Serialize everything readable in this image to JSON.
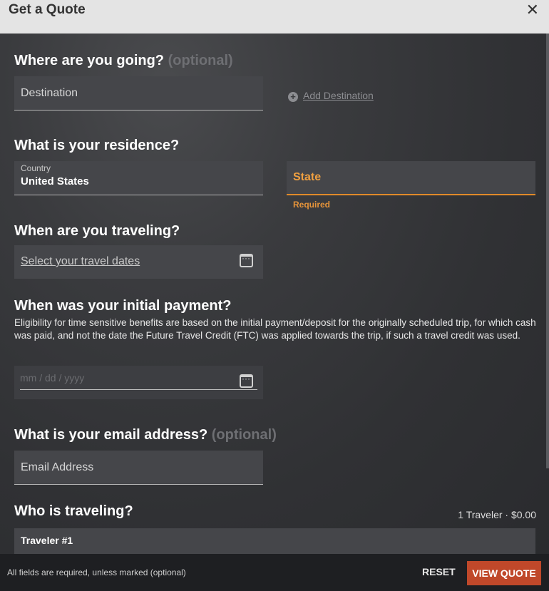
{
  "dialog": {
    "title": "Get a Quote",
    "close_icon": "close-icon",
    "close_glyph": "✕"
  },
  "destination": {
    "heading": "Where are you going?",
    "optional": "(optional)",
    "placeholder": "Destination",
    "add_label": "Add Destination",
    "add_icon": "plus-circle-icon"
  },
  "residence": {
    "heading": "What is your residence?",
    "country_label": "Country",
    "country_value": "United States",
    "state_placeholder": "State",
    "state_error": "Required",
    "accent_color": "#e08a2a"
  },
  "travel_dates": {
    "heading": "When are you traveling?",
    "link": "Select your travel dates",
    "icon": "calendar-icon"
  },
  "payment": {
    "heading": "When was your initial payment?",
    "description": "Eligibility for time sensitive benefits are based on the initial payment/deposit for the originally scheduled trip, for which cash was paid, and not the date the Future Travel Credit (FTC) was applied towards the trip, if such a travel credit was used.",
    "placeholder": "mm / dd / yyyy",
    "icon": "calendar-icon"
  },
  "email": {
    "heading": "What is your email address?",
    "optional": "(optional)",
    "placeholder": "Email Address"
  },
  "travelers": {
    "heading": "Who is traveling?",
    "summary": "1 Traveler · $0.00",
    "items": [
      {
        "label": "Traveler #1"
      }
    ]
  },
  "footer": {
    "note": "All fields are required, unless marked (optional)",
    "reset_label": "RESET",
    "view_label": "VIEW QUOTE",
    "view_color": "#c0482a"
  }
}
